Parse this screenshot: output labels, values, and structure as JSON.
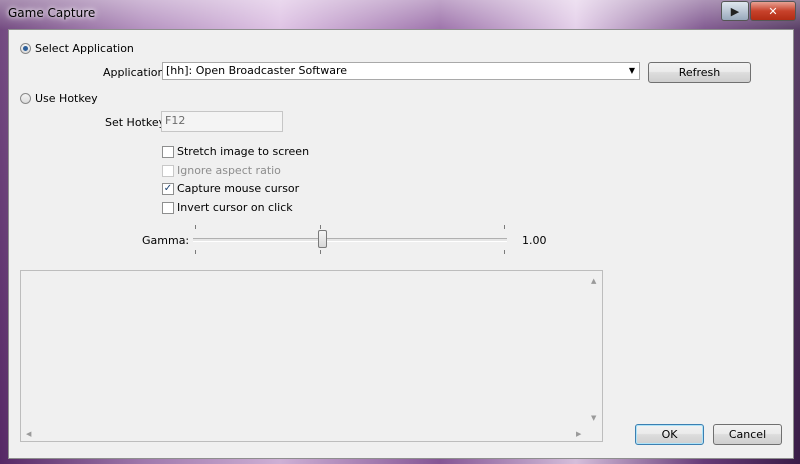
{
  "window": {
    "title": "Game Capture",
    "help_glyph": "▶",
    "close_glyph": "✕"
  },
  "select_application": {
    "label": "Select Application",
    "checked": true
  },
  "application": {
    "label": "Application:",
    "value": "[hh]: Open Broadcaster Software",
    "refresh_label": "Refresh"
  },
  "use_hotkey": {
    "label": "Use Hotkey",
    "checked": false
  },
  "hotkey": {
    "label": "Set Hotkey",
    "value": "F12"
  },
  "options": [
    {
      "label": "Stretch image to screen",
      "checked": false,
      "enabled": true
    },
    {
      "label": "Ignore aspect ratio",
      "checked": false,
      "enabled": false
    },
    {
      "label": "Capture mouse cursor",
      "checked": true,
      "enabled": true
    },
    {
      "label": "Invert cursor on click",
      "checked": false,
      "enabled": true
    }
  ],
  "gamma": {
    "label": "Gamma:",
    "value_text": "1.00",
    "slider_fraction": 0.41
  },
  "buttons": {
    "ok": "OK",
    "cancel": "Cancel"
  },
  "glyphs": {
    "check": "✓",
    "combo_arrow": "▼",
    "up": "▲",
    "down": "▼",
    "left": "◀",
    "right": "▶"
  }
}
